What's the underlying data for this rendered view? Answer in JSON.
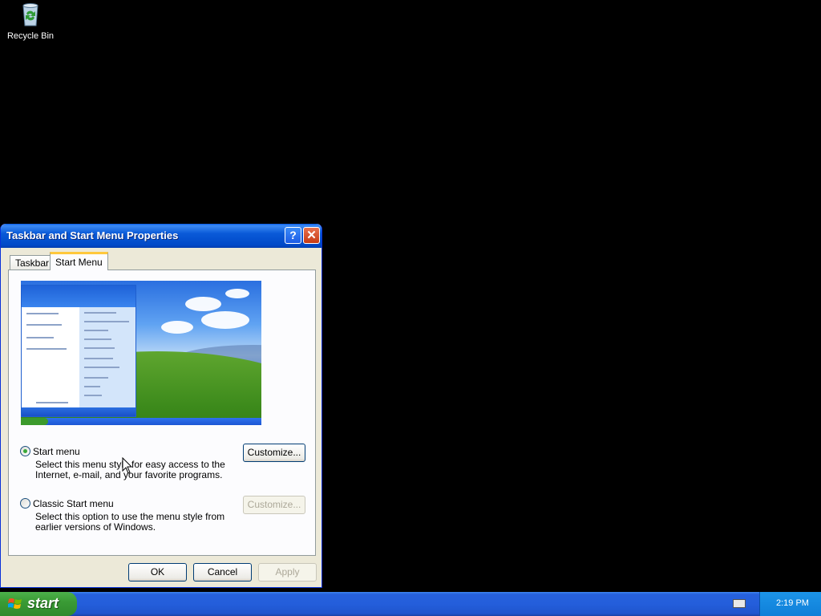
{
  "desktop": {
    "recycle_bin_label": "Recycle Bin"
  },
  "window": {
    "title": "Taskbar and Start Menu Properties",
    "tabs": [
      {
        "label": "Taskbar"
      },
      {
        "label": "Start Menu"
      }
    ],
    "active_tab": "Start Menu",
    "options": [
      {
        "label": "Start menu",
        "selected": true,
        "description": "Select this menu style for easy access to the Internet, e-mail, and your favorite programs.",
        "customize_label": "Customize...",
        "customize_enabled": true
      },
      {
        "label": "Classic Start menu",
        "selected": false,
        "description": "Select this option to use the menu style from earlier versions of Windows.",
        "customize_label": "Customize...",
        "customize_enabled": false
      }
    ],
    "buttons": {
      "ok": "OK",
      "cancel": "Cancel",
      "apply": "Apply"
    }
  },
  "taskbar": {
    "start_label": "start",
    "clock": "2:19 PM"
  },
  "colors": {
    "title_blue": "#0a5ad8",
    "start_green": "#3a9b35",
    "tray_blue": "#0f7fd8",
    "desktop": "#000000"
  }
}
